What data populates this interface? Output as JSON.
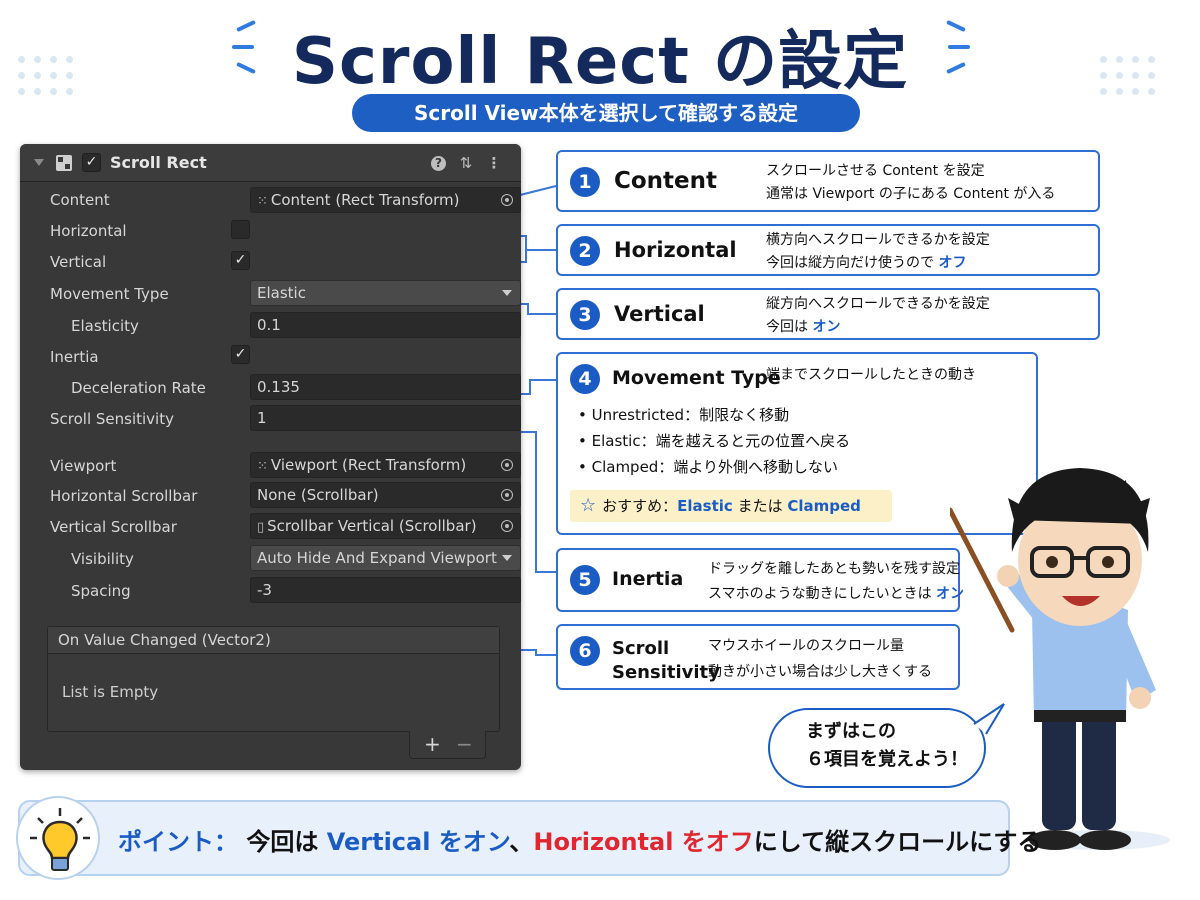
{
  "header": {
    "title": "Scroll Rect の設定",
    "subtitle": "Scroll View本体を選択して確認する設定"
  },
  "inspector": {
    "component_title": "Scroll Rect",
    "help_icon": "?",
    "preset_icon": "⇅",
    "menu_icon": "⋮",
    "checkmark": "✓",
    "rows": {
      "content_label": "Content",
      "content_value": "Content (Rect Transform)",
      "horizontal_label": "Horizontal",
      "horizontal_checked": false,
      "vertical_label": "Vertical",
      "vertical_checked": true,
      "movement_type_label": "Movement Type",
      "movement_type_value": "Elastic",
      "elasticity_label": "Elasticity",
      "elasticity_value": "0.1",
      "inertia_label": "Inertia",
      "inertia_checked": true,
      "deceleration_label": "Deceleration Rate",
      "deceleration_value": "0.135",
      "sensitivity_label": "Scroll Sensitivity",
      "sensitivity_value": "1",
      "viewport_label": "Viewport",
      "viewport_value": "Viewport (Rect Transform)",
      "h_scrollbar_label": "Horizontal Scrollbar",
      "h_scrollbar_value": "None (Scrollbar)",
      "v_scrollbar_label": "Vertical Scrollbar",
      "v_scrollbar_value": "Scrollbar Vertical (Scrollbar)",
      "visibility_label": "Visibility",
      "visibility_value": "Auto Hide And Expand Viewport",
      "spacing_label": "Spacing",
      "spacing_value": "-3"
    },
    "event": {
      "header": "On Value Changed (Vector2)",
      "empty_text": "List is Empty",
      "add": "+",
      "remove": "−"
    }
  },
  "callouts": [
    {
      "num": "1",
      "title": "Content",
      "line1": "スクロールさせる Content を設定",
      "line2": "通常は Viewport の子にある Content が入る"
    },
    {
      "num": "2",
      "title": "Horizontal",
      "line1": "横方向へスクロールできるかを設定",
      "line2_pre": "今回は縦方向だけ使うので ",
      "line2_em": "オフ"
    },
    {
      "num": "3",
      "title": "Vertical",
      "line1": "縦方向へスクロールできるかを設定",
      "line2_pre": "今回は ",
      "line2_em": "オン"
    },
    {
      "num": "4",
      "title": "Movement Type",
      "line1": "端までスクロールしたときの動き",
      "bullets": [
        "• Unrestricted：制限なく移動",
        "• Elastic：端を越えると元の位置へ戻る",
        "• Clamped：端より外側へ移動しない"
      ],
      "rec_star": "☆",
      "rec_pre": "おすすめ：",
      "rec_a": "Elastic",
      "rec_mid": " または ",
      "rec_b": "Clamped"
    },
    {
      "num": "5",
      "title": "Inertia",
      "line1": "ドラッグを離したあとも勢いを残す設定",
      "line2_pre": "スマホのような動きにしたいときは ",
      "line2_em": "オン"
    },
    {
      "num": "6",
      "title_a": "Scroll",
      "title_b": "Sensitivity",
      "line1": "マウスホイールのスクロール量",
      "line2": "動きが小さい場合は少し大きくする"
    }
  ],
  "point": {
    "label": "ポイント：",
    "t1": " 今回は ",
    "v": "Vertical をオン",
    "t2": "、",
    "h": "Horizontal をオフ",
    "t3": "にして縦スクロールにする"
  },
  "bubble": {
    "line1": "まずはこの",
    "line2": "６項目を覚えよう！"
  },
  "colors": {
    "accent": "#1b5cc4",
    "title": "#14295c",
    "warning": "#e0262e",
    "inspector_bg": "#383838"
  }
}
